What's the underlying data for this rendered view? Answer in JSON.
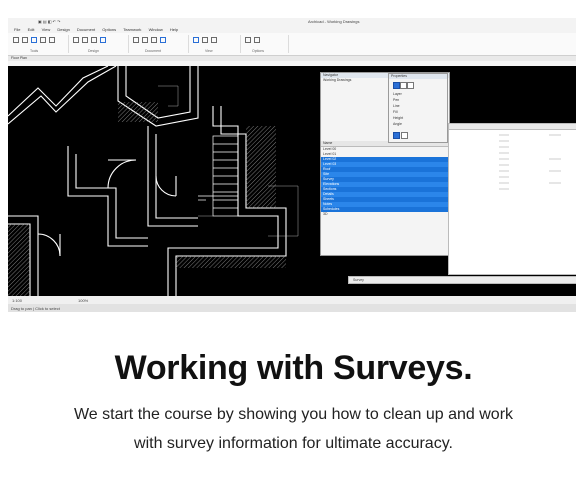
{
  "app": {
    "title": "Archicad - Working Drawings",
    "menu": [
      "File",
      "Edit",
      "View",
      "Design",
      "Document",
      "Options",
      "Teamwork",
      "Window",
      "Help"
    ],
    "tabs": [
      "Floor Plan"
    ],
    "ribbon_groups": [
      "Tools",
      "Design",
      "Document",
      "View",
      "Options",
      "Teamwork",
      "Window",
      "Help"
    ]
  },
  "dialogs": {
    "navigator": {
      "title": "Navigator",
      "tree_root": "Working Drawings",
      "list_header": "Name",
      "rows": [
        "Level 00",
        "Level 01",
        "Level 02",
        "Level 03",
        "Roof",
        "Site",
        "Survey",
        "Elevations",
        "Sections",
        "Details",
        "Sheets",
        "Notes",
        "Schedules",
        "3D"
      ]
    },
    "properties": {
      "title": "Properties",
      "rows": [
        "Layer",
        "Pen",
        "Line",
        "Fill",
        "Height",
        "Angle"
      ]
    }
  },
  "statusbar": {
    "scale": "1:100",
    "zoom": "100%",
    "left_text": "Survey",
    "hint": "Drag to pan | Click to select"
  },
  "caption": {
    "heading": "Working with Surveys.",
    "description": "We start the course by showing you how to clean up and work with survey information for ultimate accuracy."
  },
  "colors": {
    "accent": "#1a73d9",
    "canvas": "#000000",
    "drawing_lines": "#ffffff"
  }
}
